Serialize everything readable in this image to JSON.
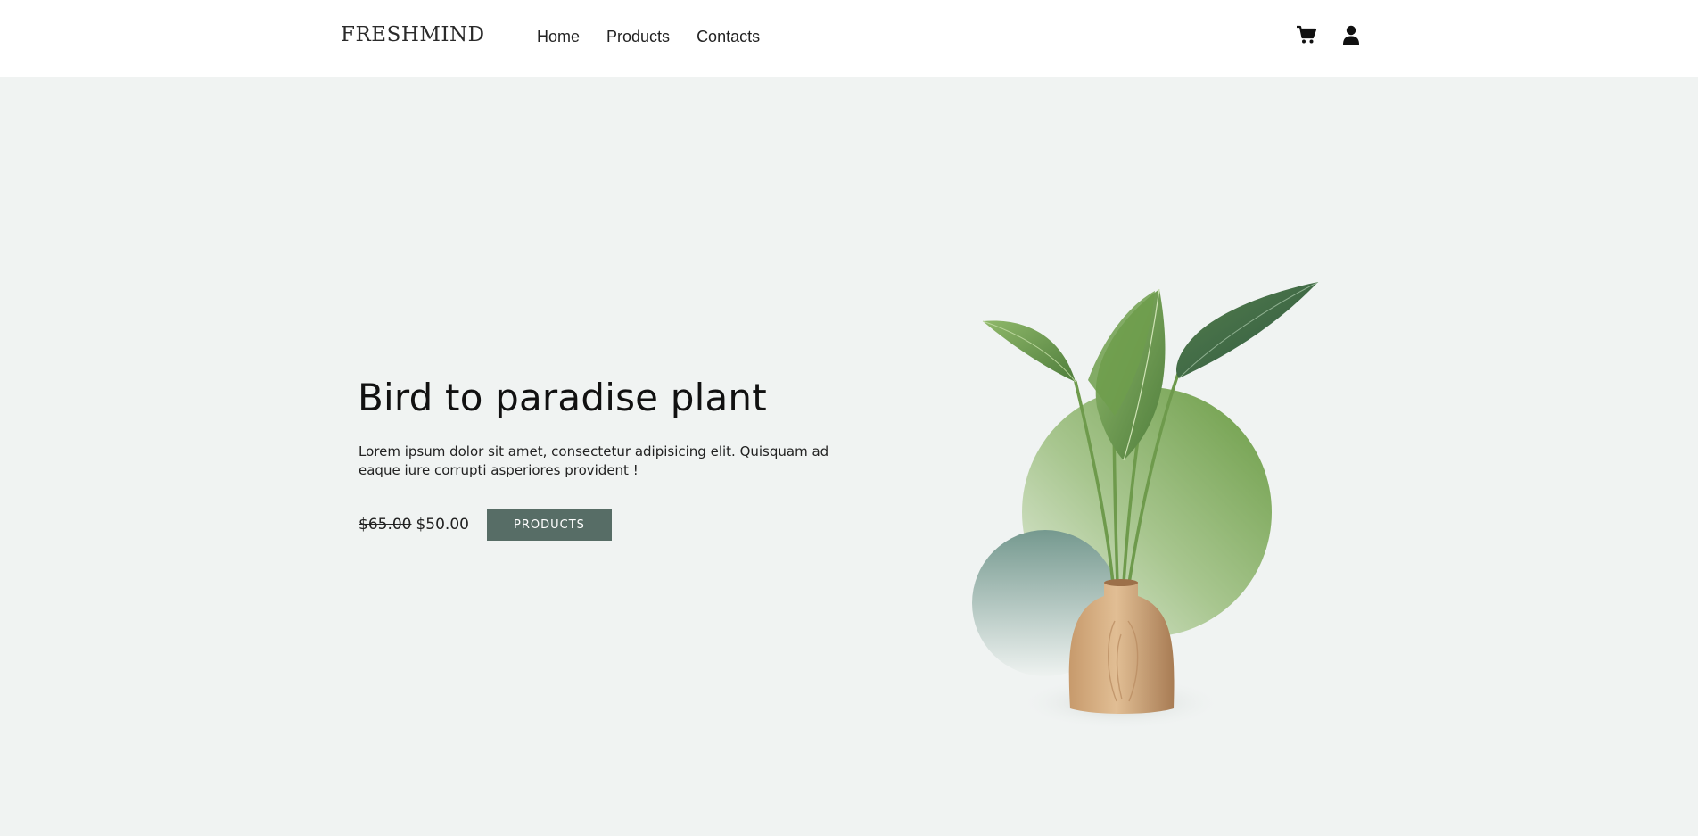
{
  "header": {
    "logo": "FRESHMIND",
    "nav": [
      "Home",
      "Products",
      "Contacts"
    ],
    "icons": [
      "cart-icon",
      "user-icon"
    ]
  },
  "hero": {
    "title": "Bird to paradise plant",
    "description": "Lorem ipsum dolor sit amet, consectetur adipisicing elit. Quisquam ad eaque iure corrupti asperiores provident !",
    "old_price": "$65.00",
    "new_price": "$50.00",
    "button": "PRODUCTS"
  },
  "colors": {
    "hero_bg": "#f0f3f2",
    "button_bg": "#576d66",
    "circle_green": "#6f9e4a",
    "circle_teal": "#7a9f96"
  }
}
